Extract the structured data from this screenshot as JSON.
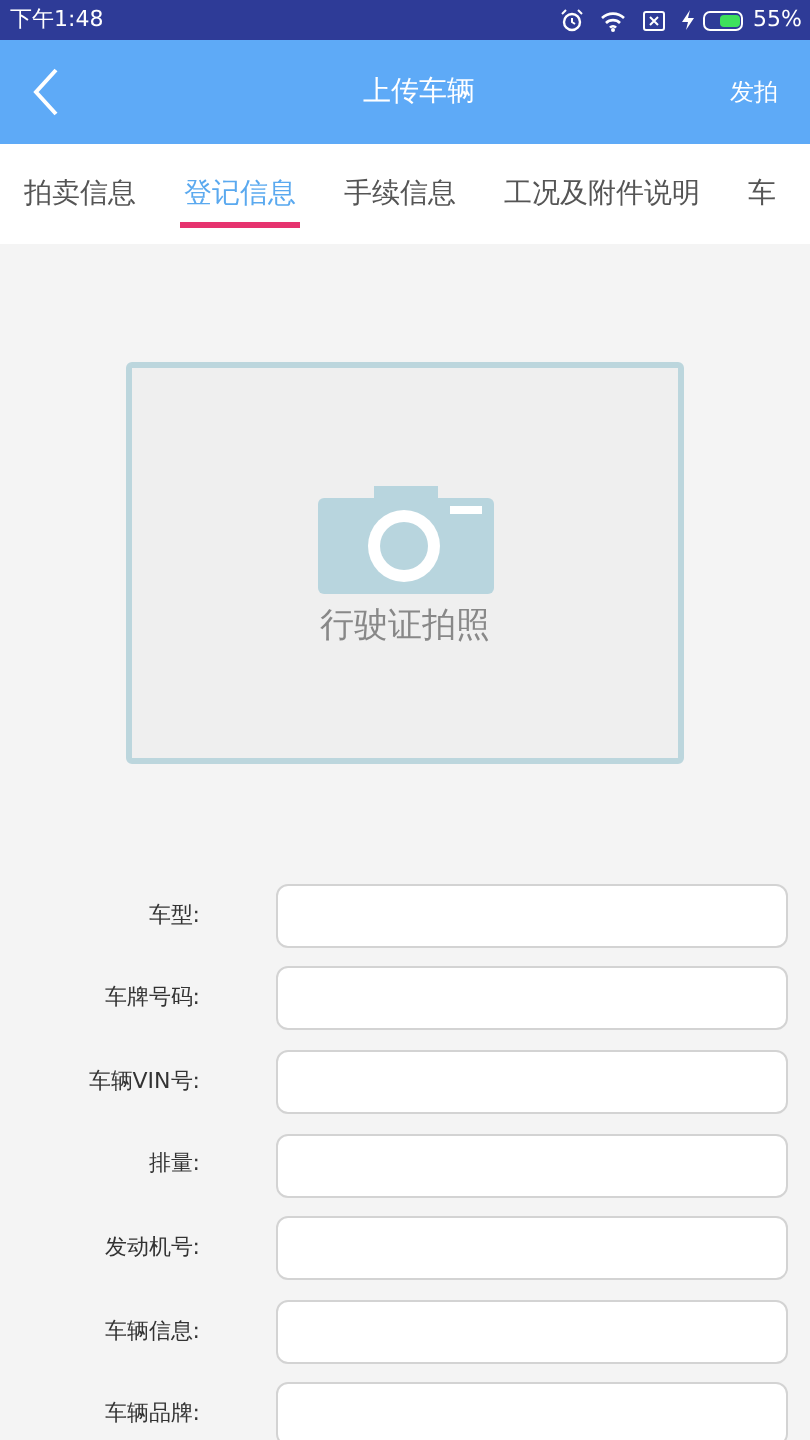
{
  "status_bar": {
    "time": "下午1:48",
    "battery": "55%"
  },
  "app_bar": {
    "title": "上传车辆",
    "action": "发拍"
  },
  "tabs": [
    {
      "label": "拍卖信息",
      "selected": false
    },
    {
      "label": "登记信息",
      "selected": true
    },
    {
      "label": "手续信息",
      "selected": false
    },
    {
      "label": "工况及附件说明",
      "selected": false
    },
    {
      "label": "车",
      "selected": false
    }
  ],
  "photo_upload": {
    "label": "行驶证拍照"
  },
  "form_fields": [
    {
      "label": "车型:"
    },
    {
      "label": "车牌号码:"
    },
    {
      "label": "车辆VIN号:"
    },
    {
      "label": "排量:"
    },
    {
      "label": "发动机号:"
    },
    {
      "label": "车辆信息:"
    },
    {
      "label": "车辆品牌:"
    }
  ]
}
